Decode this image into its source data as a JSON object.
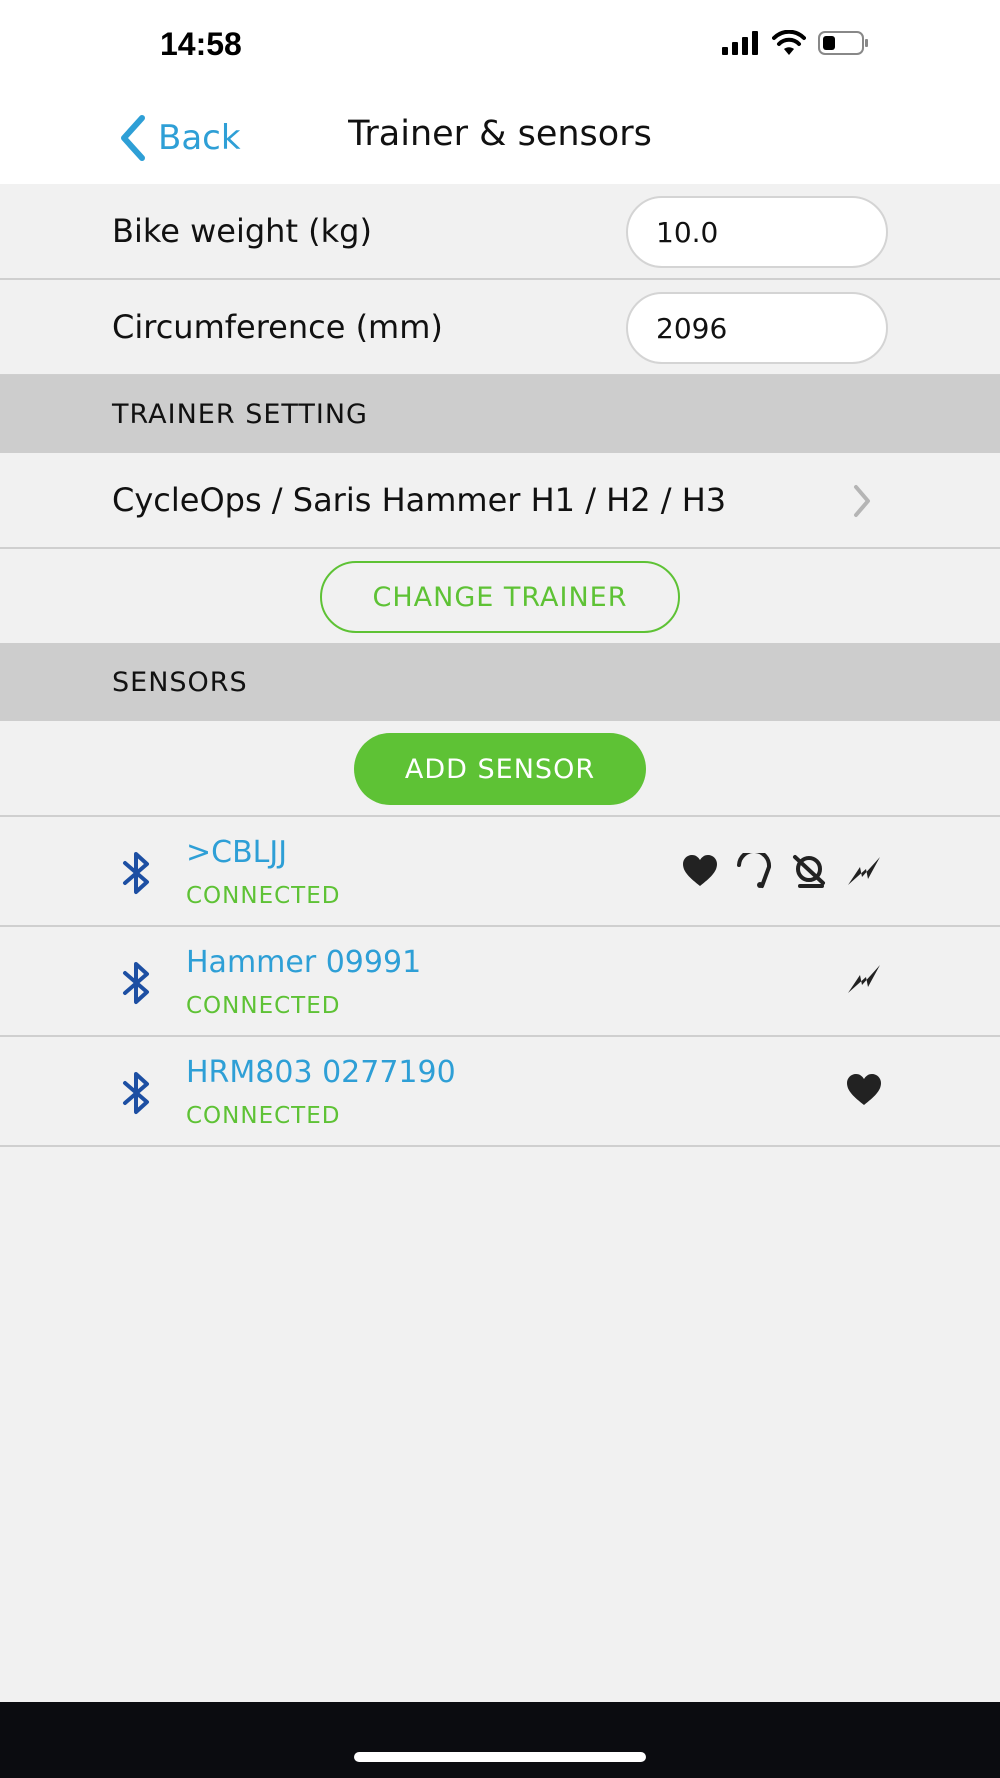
{
  "status_bar": {
    "time": "14:58"
  },
  "nav": {
    "back_label": "Back",
    "title": "Trainer & sensors"
  },
  "fields": {
    "bike_weight": {
      "label": "Bike weight (kg)",
      "value": "10.0"
    },
    "circumference": {
      "label": "Circumference (mm)",
      "value": "2096"
    }
  },
  "trainer_section": {
    "header": "TRAINER SETTING",
    "trainer_name": "CycleOps / Saris Hammer H1 / H2 / H3",
    "change_button": "CHANGE TRAINER"
  },
  "sensors_section": {
    "header": "SENSORS",
    "add_button": "ADD SENSOR",
    "items": [
      {
        "name": ">CBLJJ",
        "status": "CONNECTED",
        "icons": [
          "heart-icon",
          "speed-icon",
          "cadence-icon",
          "power-icon"
        ]
      },
      {
        "name": "Hammer 09991",
        "status": "CONNECTED",
        "icons": [
          "power-icon"
        ]
      },
      {
        "name": "HRM803 0277190",
        "status": "CONNECTED",
        "icons": [
          "heart-icon"
        ]
      }
    ]
  },
  "colors": {
    "accent_blue": "#2e9fd6",
    "accent_green": "#5ec235",
    "bluetooth_blue": "#1d4fa3",
    "section_gray": "#cdcdcd",
    "background": "#f1f1f1"
  }
}
